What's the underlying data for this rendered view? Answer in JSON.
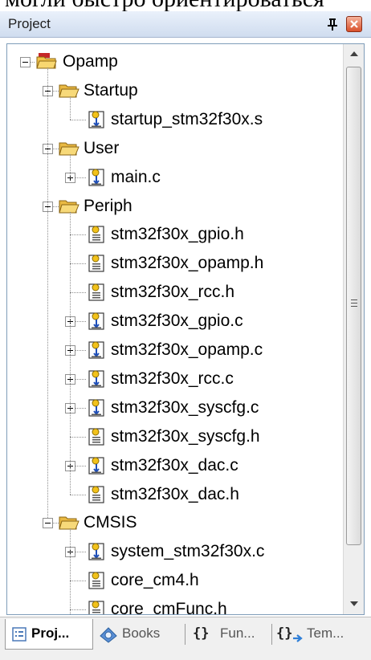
{
  "top_text": "могли быстро ориентироваться",
  "panel": {
    "title": "Project"
  },
  "tree": {
    "root": "Opamp",
    "startup": {
      "label": "Startup",
      "files": [
        "startup_stm32f30x.s"
      ]
    },
    "user": {
      "label": "User",
      "files": [
        "main.c"
      ]
    },
    "periph": {
      "label": "Periph",
      "files": [
        "stm32f30x_gpio.h",
        "stm32f30x_opamp.h",
        "stm32f30x_rcc.h",
        "stm32f30x_gpio.c",
        "stm32f30x_opamp.c",
        "stm32f30x_rcc.c",
        "stm32f30x_syscfg.c",
        "stm32f30x_syscfg.h",
        "stm32f30x_dac.c",
        "stm32f30x_dac.h"
      ]
    },
    "cmsis": {
      "label": "CMSIS",
      "files": [
        "system_stm32f30x.c",
        "core_cm4.h",
        "core_cmFunc.h"
      ]
    }
  },
  "tabs": {
    "project": "Proj...",
    "books": "Books",
    "functions": "Fun...",
    "templates": "Tem..."
  },
  "colors": {
    "header_bg": "#dbe5f4",
    "border": "#7f9db9",
    "folder": "#f0c24b",
    "close": "#d9502a"
  }
}
